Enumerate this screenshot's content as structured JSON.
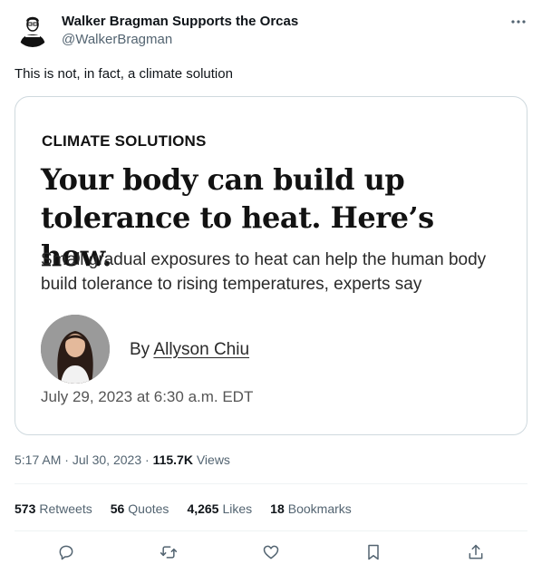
{
  "author": {
    "display_name": "Walker Bragman Supports the Orcas",
    "handle": "@WalkerBragman"
  },
  "tweet": {
    "text": "This is not, in fact, a climate solution"
  },
  "card": {
    "kicker": "CLIMATE SOLUTIONS",
    "headline": "Your body can build up tolerance to heat. Here’s how.",
    "dek": "Small gradual exposures to heat can help the human body build tolerance to rising temperatures, experts say",
    "byline_prefix": "By",
    "byline_author": "Allyson Chiu",
    "date": "July 29, 2023 at 6:30 a.m. EDT"
  },
  "meta": {
    "time": "5:17 AM",
    "separator": "·",
    "date": "Jul 30, 2023",
    "views_count": "115.7K",
    "views_label": "Views"
  },
  "stats": {
    "retweets_count": "573",
    "retweets_label": "Retweets",
    "quotes_count": "56",
    "quotes_label": "Quotes",
    "likes_count": "4,265",
    "likes_label": "Likes",
    "bookmarks_count": "18",
    "bookmarks_label": "Bookmarks"
  },
  "icons": {
    "more": "more-horizontal-icon",
    "reply": "reply-icon",
    "retweet": "retweet-icon",
    "like": "heart-icon",
    "bookmark": "bookmark-icon",
    "share": "share-icon"
  },
  "colors": {
    "text_primary": "#0f1419",
    "text_secondary": "#536471",
    "border": "#cfd9de"
  }
}
